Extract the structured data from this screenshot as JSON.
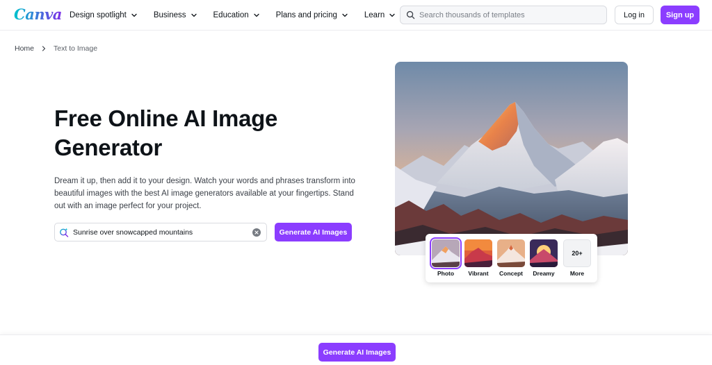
{
  "header": {
    "logo": "Canva",
    "nav": [
      {
        "label": "Design spotlight"
      },
      {
        "label": "Business"
      },
      {
        "label": "Education"
      },
      {
        "label": "Plans and pricing"
      },
      {
        "label": "Learn"
      }
    ],
    "search_placeholder": "Search thousands of templates",
    "login_label": "Log in",
    "signup_label": "Sign up"
  },
  "breadcrumb": {
    "home": "Home",
    "current": "Text to Image"
  },
  "hero": {
    "title": "Free Online AI Image Generator",
    "description": "Dream it up, then add it to your design. Watch your words and phrases transform into beautiful images with the best AI image generators available at your fingertips. Stand out with an image perfect for your project.",
    "prompt_value": "Sunrise over snowcapped mountains",
    "generate_label": "Generate AI Images"
  },
  "styles": {
    "items": [
      {
        "label": "Photo",
        "selected": true
      },
      {
        "label": "Vibrant"
      },
      {
        "label": "Concept"
      },
      {
        "label": "Dreamy"
      }
    ],
    "more_count": "20+",
    "more_label": "More"
  },
  "bottom_bar": {
    "generate_label": "Generate AI Images"
  },
  "colors": {
    "brand_purple": "#8b3dff",
    "text_dark": "#0e1318"
  }
}
